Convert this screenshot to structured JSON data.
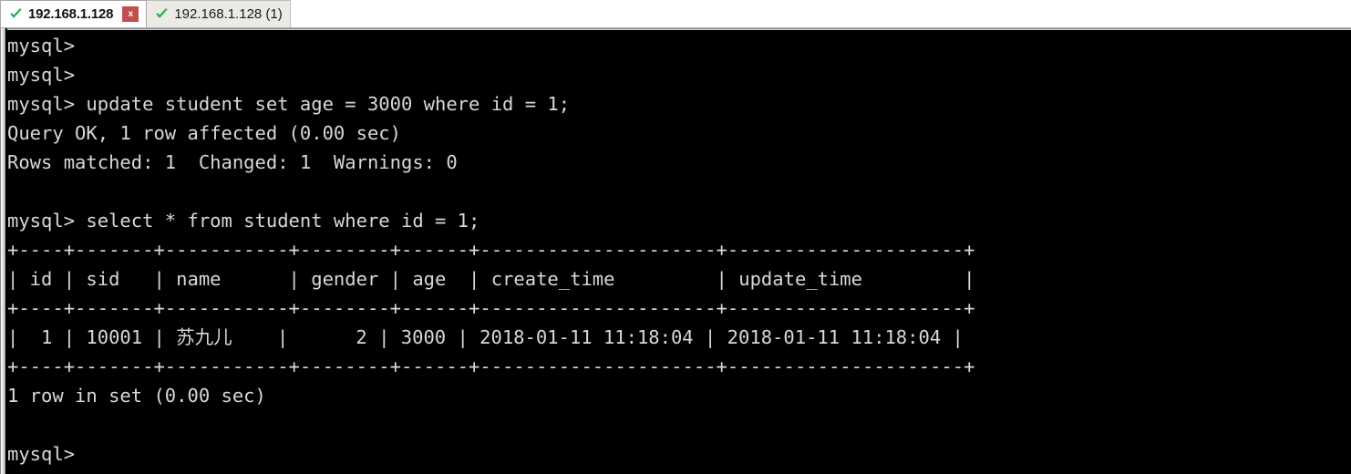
{
  "window": {
    "type": "ssh-terminal-client",
    "tab_bar_background": "#ffffff",
    "terminal_background": "#000000",
    "terminal_foreground": "#d8d8d8"
  },
  "tabs": [
    {
      "label": "192.168.1.128",
      "status_icon": "green-check-icon",
      "status_color": "#22b14c",
      "active": true,
      "has_close_button": true,
      "close_label": "x",
      "close_color": "#c0504d"
    },
    {
      "label": "192.168.1.128 (1)",
      "status_icon": "green-check-icon",
      "status_color": "#22b14c",
      "active": false,
      "has_close_button": false
    }
  ],
  "terminal": {
    "prompt": "mysql>",
    "lines": [
      "mysql>",
      "mysql>",
      "mysql> update student set age = 3000 where id = 1;",
      "Query OK, 1 row affected (0.00 sec)",
      "Rows matched: 1  Changed: 1  Warnings: 0",
      "",
      "mysql> select * from student where id = 1;",
      "+----+-------+-----------+--------+------+---------------------+---------------------+",
      "| id | sid   | name      | gender | age  | create_time         | update_time         |",
      "+----+-------+-----------+--------+------+---------------------+---------------------+",
      "|  1 | 10001 | 苏九儿    |      2 | 3000 | 2018-01-11 11:18:04 | 2018-01-11 11:18:04 |",
      "+----+-------+-----------+--------+------+---------------------+---------------------+",
      "1 row in set (0.00 sec)",
      "",
      "mysql>"
    ],
    "commands": [
      "update student set age = 3000 where id = 1;",
      "select * from student where id = 1;"
    ],
    "results": {
      "update_status": "Query OK, 1 row affected (0.00 sec)",
      "update_detail": "Rows matched: 1  Changed: 1  Warnings: 0",
      "select_status": "1 row in set (0.00 sec)"
    },
    "result_table": {
      "columns": [
        "id",
        "sid",
        "name",
        "gender",
        "age",
        "create_time",
        "update_time"
      ],
      "rows": [
        {
          "id": "1",
          "sid": "10001",
          "name": "苏九儿",
          "gender": "2",
          "age": "3000",
          "create_time": "2018-01-11 11:18:04",
          "update_time": "2018-01-11 11:18:04"
        }
      ]
    }
  }
}
